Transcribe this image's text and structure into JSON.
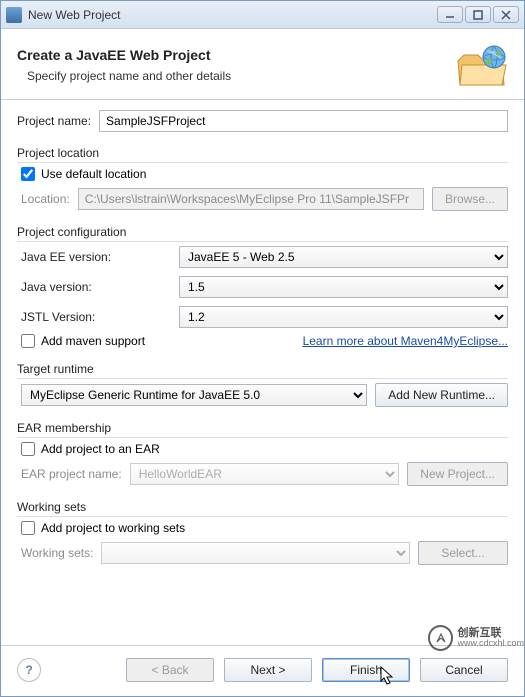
{
  "window": {
    "title": "New Web Project"
  },
  "banner": {
    "heading": "Create a JavaEE Web Project",
    "subtitle": "Specify project name and other details"
  },
  "project_name": {
    "label": "Project name:",
    "value": "SampleJSFProject"
  },
  "location": {
    "group": "Project location",
    "use_default_label": "Use default location",
    "use_default": true,
    "label": "Location:",
    "value": "C:\\Users\\lstrain\\Workspaces\\MyEclipse Pro 11\\SampleJSFPr",
    "browse": "Browse..."
  },
  "config": {
    "group": "Project configuration",
    "ee_label": "Java EE version:",
    "ee_value": "JavaEE 5 - Web 2.5",
    "java_label": "Java version:",
    "java_value": "1.5",
    "jstl_label": "JSTL Version:",
    "jstl_value": "1.2",
    "maven_checked": false,
    "maven_label": "Add maven support",
    "maven_link": "Learn more about Maven4MyEclipse..."
  },
  "runtime": {
    "group": "Target runtime",
    "value": "MyEclipse Generic Runtime for JavaEE 5.0",
    "add": "Add New Runtime..."
  },
  "ear": {
    "group": "EAR membership",
    "add_checked": false,
    "add_label": "Add project to an EAR",
    "name_label": "EAR project name:",
    "name_value": "HelloWorldEAR",
    "new": "New Project..."
  },
  "ws": {
    "group": "Working sets",
    "add_checked": false,
    "add_label": "Add project to working sets",
    "sets_label": "Working sets:",
    "select": "Select..."
  },
  "buttons": {
    "back": "< Back",
    "next": "Next >",
    "finish": "Finish",
    "cancel": "Cancel"
  },
  "watermark": {
    "top": "创新互联",
    "bottom": "www.cdcxhl.com"
  }
}
